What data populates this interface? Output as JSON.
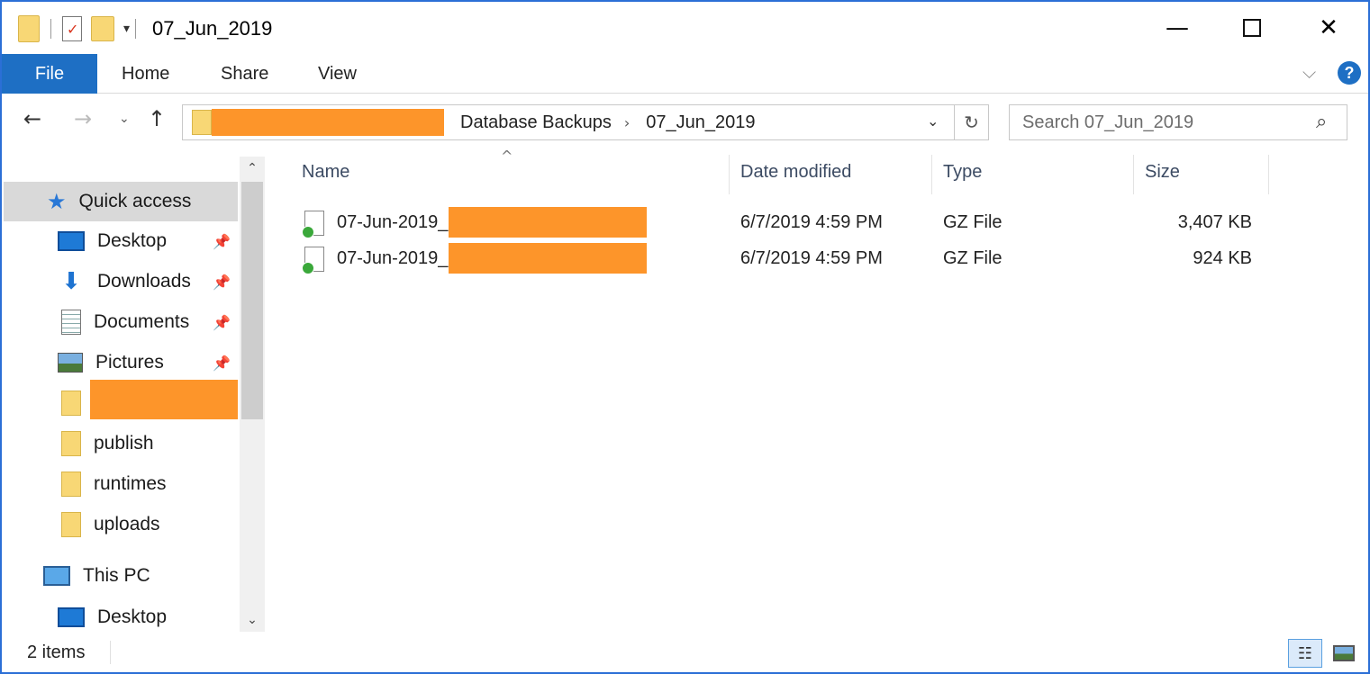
{
  "window": {
    "title": "07_Jun_2019",
    "controls": {
      "minimize": "—",
      "maximize": "",
      "close": "✕"
    }
  },
  "ribbon": {
    "tabs": [
      {
        "label": "File"
      },
      {
        "label": "Home"
      },
      {
        "label": "Share"
      },
      {
        "label": "View"
      }
    ],
    "accent_color": "#1e6fc4",
    "help_label": "?"
  },
  "address": {
    "crumbs": [
      "Database Backups",
      "07_Jun_2019"
    ],
    "redacted_color": "#fd952a"
  },
  "search": {
    "placeholder": "Search 07_Jun_2019"
  },
  "sidebar": {
    "quick_access": "Quick access",
    "items": [
      {
        "label": "Desktop",
        "icon": "desktop-icon",
        "pinned": true
      },
      {
        "label": "Downloads",
        "icon": "download-icon",
        "pinned": true
      },
      {
        "label": "Documents",
        "icon": "documents-icon",
        "pinned": true
      },
      {
        "label": "Pictures",
        "icon": "pictures-icon",
        "pinned": true
      },
      {
        "label": "",
        "icon": "folder-icon",
        "pinned": false,
        "redacted": true
      },
      {
        "label": "publish",
        "icon": "folder-icon",
        "pinned": false
      },
      {
        "label": "runtimes",
        "icon": "folder-icon",
        "pinned": false
      },
      {
        "label": "uploads",
        "icon": "folder-icon",
        "pinned": false
      }
    ],
    "this_pc": "This PC",
    "this_pc_items": [
      {
        "label": "Desktop",
        "icon": "desktop-icon"
      }
    ]
  },
  "file_list": {
    "columns": [
      "Name",
      "Date modified",
      "Type",
      "Size"
    ],
    "sort_indicator": "^",
    "rows": [
      {
        "name": "07-Jun-2019_",
        "date": "6/7/2019 4:59 PM",
        "type": "GZ File",
        "size": "3,407 KB"
      },
      {
        "name": "07-Jun-2019_",
        "date": "6/7/2019 4:59 PM",
        "type": "GZ File",
        "size": "924 KB"
      }
    ]
  },
  "status": {
    "count": "2 items"
  }
}
